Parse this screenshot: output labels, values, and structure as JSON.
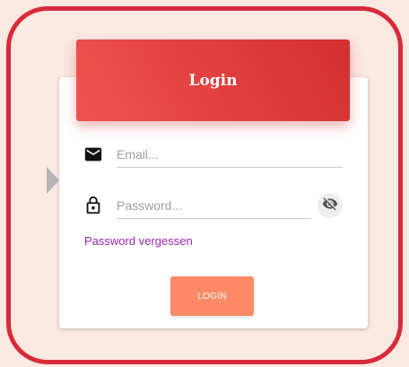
{
  "card": {
    "title": "Login"
  },
  "email": {
    "icon": "mail-icon",
    "value": "",
    "placeholder": "Email..."
  },
  "password": {
    "icon": "lock-icon",
    "value": "",
    "placeholder": "Password...",
    "toggle_icon": "eye-off-icon"
  },
  "forgot_password": "Password vergessen",
  "login_button": "LOGIN",
  "colors": {
    "background": "#fbe9e2",
    "frame": "#d92a3a",
    "header_start": "#ef5350",
    "header_end": "#d32f2f",
    "link": "#9c27b0",
    "button": "#ff8a65"
  }
}
